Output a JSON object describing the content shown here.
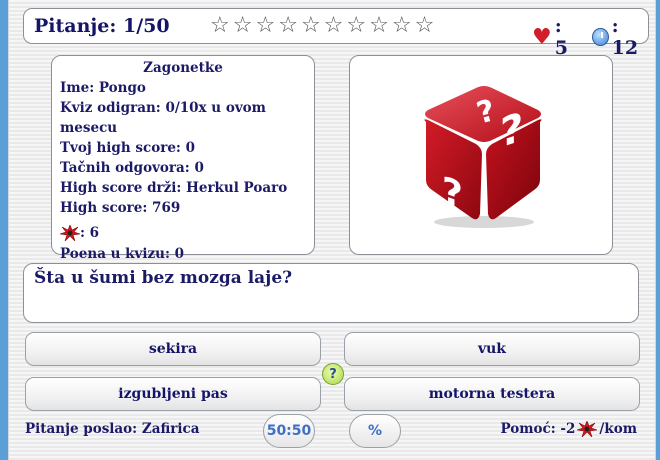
{
  "header": {
    "question_counter": "Pitanje: 1/50",
    "stars_total": 10,
    "lives": ": 5",
    "timer": ": 12"
  },
  "info": {
    "title": "Zagonetke",
    "name": "Ime: Pongo",
    "played": "Kviz odigran: 0/10x u ovom mesecu",
    "high_score": "Tvoj high score: 0",
    "correct": "Tačnih odgovora: 0",
    "high_score_holder": "High score drži: Herkul Poaro",
    "top_high_score": "High score: 769",
    "bombs": ": 6",
    "quiz_points": "Poena u kvizu: 0"
  },
  "question": {
    "text": "Šta u šumi bez mozga laje?"
  },
  "answers": [
    "sekira",
    "vuk",
    "izgubljeni pas",
    "motorna testera"
  ],
  "hint_icon": "?",
  "footer": {
    "sent_by": "Pitanje poslao: Zafirica",
    "fifty_fifty": "50:50",
    "percent": "%",
    "help_prefix": "Pomoć: -2",
    "help_suffix": "/kom"
  },
  "colors": {
    "text": "#141468",
    "accent_blue": "#3f6fc4",
    "heart": "#d21e2a",
    "dice_red": "#c8101e",
    "background": "#5b9fd6"
  }
}
